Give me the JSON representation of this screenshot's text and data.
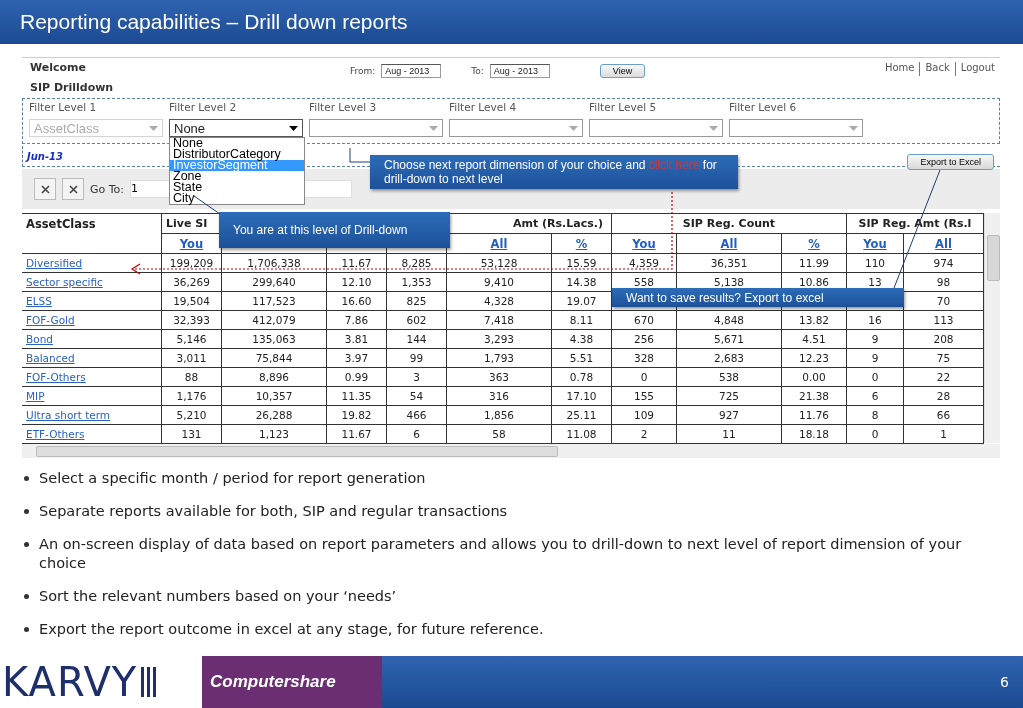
{
  "title": "Reporting capabilities – Drill down reports",
  "app": {
    "welcome": "Welcome",
    "page_title": "SIP Drilldown",
    "from_label": "From:",
    "from_value": "Aug - 2013",
    "to_label": "To:",
    "to_value": "Aug - 2013",
    "view_button": "View",
    "nav_links": [
      "Home",
      "Back",
      "Logout"
    ],
    "filters": [
      {
        "label": "Filter Level 1",
        "value": "AssetClass",
        "disabled": true,
        "expanded": false
      },
      {
        "label": "Filter Level 2",
        "value": "None",
        "disabled": false,
        "expanded": true
      },
      {
        "label": "Filter Level 3",
        "disabled": false,
        "expanded": false
      },
      {
        "label": "Filter Level 4",
        "disabled": false,
        "expanded": false
      },
      {
        "label": "Filter Level 5",
        "disabled": false,
        "expanded": false
      },
      {
        "label": "Filter Level 6",
        "disabled": false,
        "expanded": false
      }
    ],
    "dropdown_options": [
      {
        "label": "None",
        "selected": false
      },
      {
        "label": "DistributorCategory",
        "selected": false
      },
      {
        "label": "InvestorSegment",
        "selected": true
      },
      {
        "label": "Zone",
        "selected": false
      },
      {
        "label": "State",
        "selected": false
      },
      {
        "label": "City",
        "selected": false
      }
    ],
    "period": "Jun-13",
    "export_button": "Export to Excel",
    "goto_label": "Go To:",
    "goto_value": "1",
    "table": {
      "first_header": "AssetClass",
      "groups": [
        {
          "label": "Live SI",
          "columns": [
            "You",
            null,
            null
          ]
        },
        {
          "label": "Amt (Rs.Lacs.)",
          "columns": [
            null,
            "All",
            "%"
          ]
        },
        {
          "label": "SIP Reg. Count",
          "columns": [
            "You",
            "All",
            "%"
          ]
        },
        {
          "label": "SIP Reg. Amt (Rs.l",
          "columns": [
            "You",
            "All"
          ]
        }
      ],
      "rows": [
        {
          "name": "Diversified",
          "cells": [
            "199,209",
            "1,706,338",
            "11.67",
            "8,285",
            "53,128",
            "15.59",
            "4,359",
            "36,351",
            "11.99",
            "110",
            "974"
          ]
        },
        {
          "name": "Sector specific",
          "cells": [
            "36,269",
            "299,640",
            "12.10",
            "1,353",
            "9,410",
            "14.38",
            "558",
            "5,138",
            "10.86",
            "13",
            "98"
          ]
        },
        {
          "name": "ELSS",
          "cells": [
            "19,504",
            "117,523",
            "16.60",
            "825",
            "4,328",
            "19.07",
            null,
            null,
            null,
            null,
            "70"
          ]
        },
        {
          "name": "FOF-Gold",
          "cells": [
            "32,393",
            "412,079",
            "7.86",
            "602",
            "7,418",
            "8.11",
            "670",
            "4,848",
            "13.82",
            "16",
            "113"
          ]
        },
        {
          "name": "Bond",
          "cells": [
            "5,146",
            "135,063",
            "3.81",
            "144",
            "3,293",
            "4.38",
            "256",
            "5,671",
            "4.51",
            "9",
            "208"
          ]
        },
        {
          "name": "Balanced",
          "cells": [
            "3,011",
            "75,844",
            "3.97",
            "99",
            "1,793",
            "5.51",
            "328",
            "2,683",
            "12.23",
            "9",
            "75"
          ]
        },
        {
          "name": "FOF-Others",
          "cells": [
            "88",
            "8,896",
            "0.99",
            "3",
            "363",
            "0.78",
            "0",
            "538",
            "0.00",
            "0",
            "22"
          ]
        },
        {
          "name": "MIP",
          "cells": [
            "1,176",
            "10,357",
            "11.35",
            "54",
            "316",
            "17.10",
            "155",
            "725",
            "21.38",
            "6",
            "28"
          ]
        },
        {
          "name": "Ultra short term",
          "cells": [
            "5,210",
            "26,288",
            "19.82",
            "466",
            "1,856",
            "25.11",
            "109",
            "927",
            "11.76",
            "8",
            "66"
          ]
        },
        {
          "name": "ETF-Others",
          "cells": [
            "131",
            "1,123",
            "11.67",
            "6",
            "58",
            "11.08",
            "2",
            "11",
            "18.18",
            "0",
            "1"
          ]
        }
      ]
    },
    "callouts": {
      "choose_before": "Choose next report dimension of your choice and",
      "choose_link": "click here",
      "choose_after": "for drill-down to next level",
      "level": "You are at this level of Drill-down",
      "export": "Want to save results? Export to excel"
    }
  },
  "bullets": [
    "Select a specific month / period for report generation",
    "Separate reports available for both, SIP and regular transactions",
    "An on-screen display of data based on report parameters and allows you to drill-down to next level of report dimension of your choice",
    "Sort the relevant numbers based on your ‘needs’",
    "Export the report outcome in excel  at any stage, for future reference."
  ],
  "footer": {
    "brand": "KARVY",
    "partner": "Computershare",
    "page_number": "6"
  }
}
